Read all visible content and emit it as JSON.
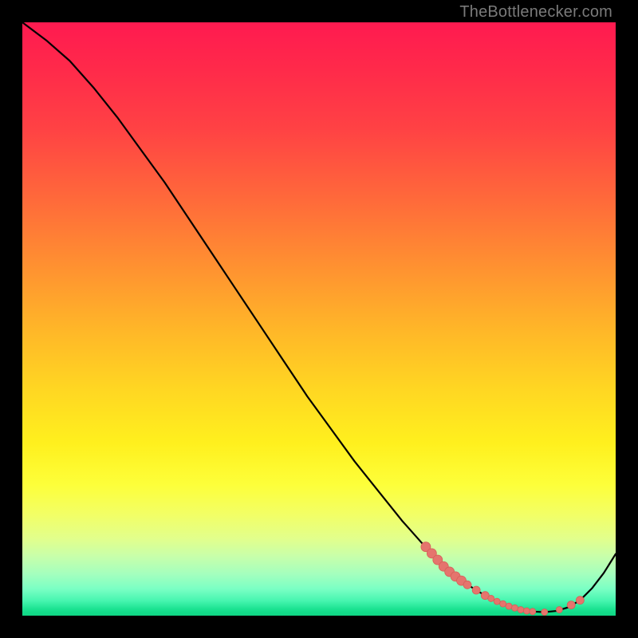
{
  "watermark": "TheBottlenecker.com",
  "colors": {
    "frame": "#000000",
    "curve": "#000000",
    "marker_fill": "#e5746d",
    "marker_stroke": "#d55f58"
  },
  "chart_data": {
    "type": "line",
    "title": "",
    "xlabel": "",
    "ylabel": "",
    "xlim": [
      0,
      100
    ],
    "ylim": [
      0,
      100
    ],
    "series": [
      {
        "name": "bottleneck-curve",
        "x": [
          0,
          4,
          8,
          12,
          16,
          20,
          24,
          28,
          32,
          36,
          40,
          44,
          48,
          52,
          56,
          60,
          64,
          68,
          72,
          74,
          76,
          78,
          80,
          82,
          84,
          86,
          88,
          90,
          92,
          94,
          96,
          98,
          100
        ],
        "y": [
          100,
          97,
          93.5,
          89,
          84,
          78.5,
          73,
          67,
          61,
          55,
          49,
          43,
          37,
          31.5,
          26,
          21,
          16,
          11.5,
          7.5,
          6,
          4.6,
          3.4,
          2.4,
          1.6,
          1.0,
          0.7,
          0.6,
          0.8,
          1.4,
          2.6,
          4.6,
          7.2,
          10.4
        ]
      }
    ],
    "markers": [
      {
        "x": 68.0,
        "y": 11.6,
        "r": 6
      },
      {
        "x": 69.0,
        "y": 10.5,
        "r": 6
      },
      {
        "x": 70.0,
        "y": 9.4,
        "r": 6
      },
      {
        "x": 71.0,
        "y": 8.3,
        "r": 6
      },
      {
        "x": 72.0,
        "y": 7.4,
        "r": 6
      },
      {
        "x": 73.0,
        "y": 6.6,
        "r": 6
      },
      {
        "x": 74.0,
        "y": 5.9,
        "r": 6
      },
      {
        "x": 75.0,
        "y": 5.2,
        "r": 5
      },
      {
        "x": 76.5,
        "y": 4.3,
        "r": 5
      },
      {
        "x": 78.0,
        "y": 3.4,
        "r": 5
      },
      {
        "x": 79.0,
        "y": 2.9,
        "r": 4
      },
      {
        "x": 80.0,
        "y": 2.4,
        "r": 4
      },
      {
        "x": 81.0,
        "y": 2.0,
        "r": 4
      },
      {
        "x": 82.0,
        "y": 1.6,
        "r": 4
      },
      {
        "x": 83.0,
        "y": 1.3,
        "r": 4
      },
      {
        "x": 84.0,
        "y": 1.0,
        "r": 4
      },
      {
        "x": 85.0,
        "y": 0.8,
        "r": 4
      },
      {
        "x": 86.0,
        "y": 0.7,
        "r": 4
      },
      {
        "x": 88.0,
        "y": 0.6,
        "r": 4
      },
      {
        "x": 90.5,
        "y": 1.0,
        "r": 4
      },
      {
        "x": 92.5,
        "y": 1.8,
        "r": 5
      },
      {
        "x": 94.0,
        "y": 2.6,
        "r": 5
      }
    ]
  }
}
